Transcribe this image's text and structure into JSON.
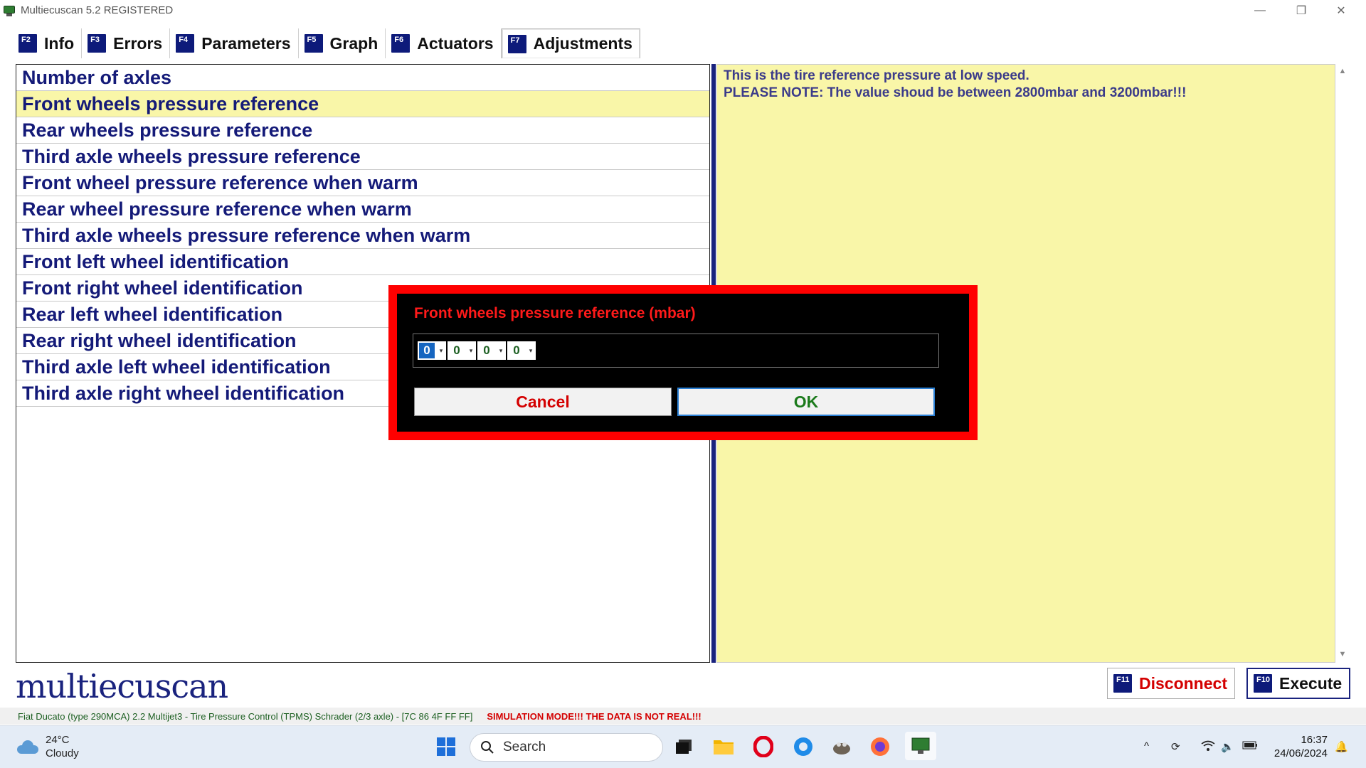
{
  "window": {
    "title": "Multiecuscan 5.2 REGISTERED",
    "controls": {
      "minimize": "—",
      "restore": "❐",
      "close": "✕"
    }
  },
  "tabs": [
    {
      "key": "F2",
      "label": "Info"
    },
    {
      "key": "F3",
      "label": "Errors"
    },
    {
      "key": "F4",
      "label": "Parameters"
    },
    {
      "key": "F5",
      "label": "Graph"
    },
    {
      "key": "F6",
      "label": "Actuators"
    },
    {
      "key": "F7",
      "label": "Adjustments"
    }
  ],
  "active_tab": "Adjustments",
  "adjustments": [
    "Number of axles",
    "Front wheels pressure reference",
    "Rear wheels pressure reference",
    "Third axle wheels pressure reference",
    "Front wheel pressure reference when warm",
    "Rear wheel pressure reference when warm",
    "Third axle wheels pressure reference when warm",
    "Front left wheel identification",
    "Front right wheel identification",
    "Rear left wheel identification",
    "Rear right wheel identification",
    "Third axle left wheel identification",
    "Third axle right wheel identification"
  ],
  "selected_adjustment": "Front wheels pressure reference",
  "description": {
    "line1": "This is the tire reference pressure at low speed.",
    "line2": "PLEASE NOTE: The value shoud be between 2800mbar and 3200mbar!!!"
  },
  "dialog": {
    "title": "Front wheels pressure reference (mbar)",
    "digits": [
      "0",
      "0",
      "0",
      "0"
    ],
    "spin_glyph": "▾",
    "cancel_label": "Cancel",
    "ok_label": "OK"
  },
  "brand": {
    "logo_text": "multiecuscan"
  },
  "buttons": {
    "disconnect": {
      "key": "F11",
      "label": "Disconnect"
    },
    "execute": {
      "key": "F10",
      "label": "Execute"
    }
  },
  "status": {
    "vehicle": "Fiat Ducato (type 290MCA) 2.2 Multijet3 - Tire Pressure Control (TPMS) Schrader (2/3 axle) - [7C 86 4F FF FF]",
    "simulation": "SIMULATION MODE!!! THE DATA IS NOT REAL!!!"
  },
  "taskbar": {
    "weather_temp": "24°C",
    "weather_desc": "Cloudy",
    "search_placeholder": "Search",
    "time": "16:37",
    "date": "24/06/2024"
  },
  "colors": {
    "list_text": "#141a78",
    "selected_bg": "#f9f6a8",
    "dialog_border": "#ff0000",
    "cancel": "#d40000",
    "ok": "#1b7a1b",
    "fkey_bg": "#0d1a7a"
  }
}
